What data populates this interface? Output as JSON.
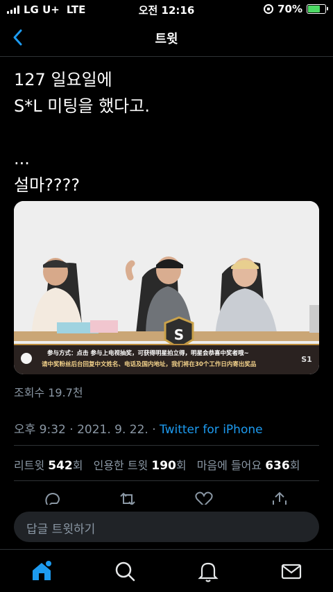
{
  "status_bar": {
    "carrier": "LG U+",
    "network": "LTE",
    "time": "오전 12:16",
    "battery": "70%",
    "battery_level": 0.7
  },
  "nav": {
    "title": "트윗",
    "back_icon": "chevron-left-icon"
  },
  "tweet": {
    "text": "127 일요일에\nS*L 미팅을 했다고.\n\n...\n설마????",
    "media": {
      "banner_line1": "参与方式：点击 参与上电视抽奖，可获得明星拍立得，明星会恭喜中奖者哦~",
      "banner_line2": "请中奖粉丝后台回复中文姓名、电话及国内地址，我们将在30个工作日内寄出奖品",
      "center_badge": "S",
      "corner_mark": "S1"
    },
    "views": "조회수 19.7천",
    "time": "오후 9:32",
    "date": "2021. 9. 22.",
    "separator": "·",
    "source": "Twitter for iPhone",
    "stats": {
      "retweets_label": "리트윗",
      "retweets": "542",
      "retweets_suffix": "회",
      "quotes_label": "인용한 트윗",
      "quotes": "190",
      "quotes_suffix": "회",
      "likes_label": "마음에 들어요",
      "likes": "636",
      "likes_suffix": "회"
    }
  },
  "actions": [
    "reply-icon",
    "retweet-icon",
    "like-icon",
    "share-icon"
  ],
  "reply": {
    "placeholder": "답글 트윗하기"
  },
  "tabbar": [
    "home-icon",
    "search-icon",
    "notifications-icon",
    "messages-icon"
  ],
  "colors": {
    "accent": "#1d9bf0",
    "background": "#000000",
    "muted": "#8b98a5",
    "divider": "#2f3336",
    "battery": "#4cd964"
  }
}
